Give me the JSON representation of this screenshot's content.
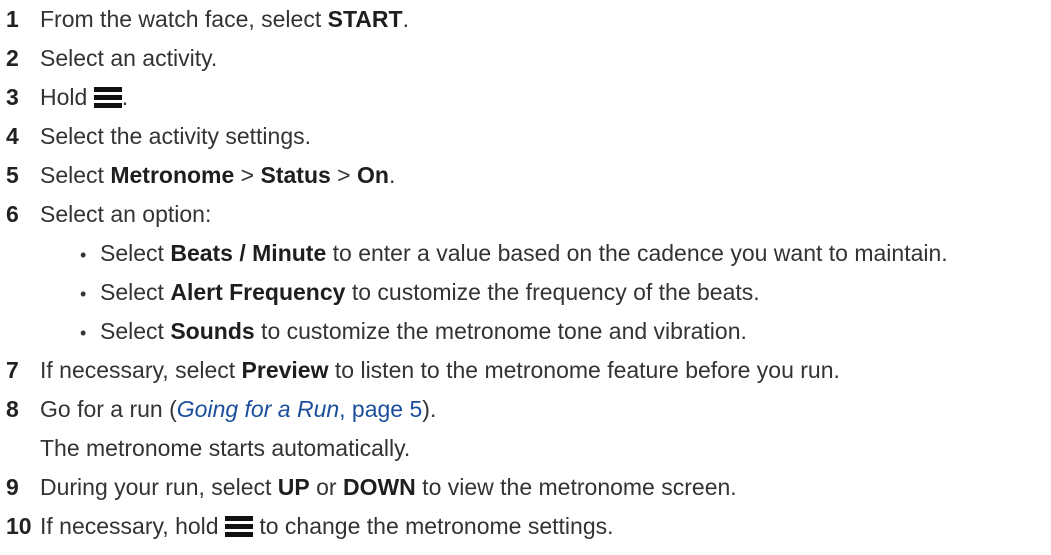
{
  "steps": [
    {
      "num": "1",
      "pre": "From the watch face, select ",
      "bold": "START",
      "post": "."
    },
    {
      "num": "2",
      "text": "Select an activity."
    },
    {
      "num": "3",
      "pre": "Hold ",
      "icon": "menu-icon",
      "post": "."
    },
    {
      "num": "4",
      "text": "Select the activity settings."
    },
    {
      "num": "5",
      "pre": "Select ",
      "b1": "Metronome",
      "sep1": " > ",
      "b2": "Status",
      "sep2": " > ",
      "b3": "On",
      "post": "."
    },
    {
      "num": "6",
      "text": "Select an option:"
    },
    {
      "num": "7",
      "pre": "If necessary, select ",
      "bold": "Preview",
      "post": " to listen to the metronome feature before you run."
    },
    {
      "num": "8",
      "pre": "Go for a run (",
      "link_italic": "Going for a Run",
      "link_page": ", page 5",
      "post": ").",
      "continuation": "The metronome starts automatically."
    },
    {
      "num": "9",
      "pre": "During your run, select ",
      "b1": "UP",
      "mid": " or ",
      "b2": "DOWN",
      "post": " to view the metronome screen."
    },
    {
      "num": "10",
      "pre": "If necessary, hold ",
      "icon": "menu-icon",
      "post": " to change the metronome settings."
    }
  ],
  "options": [
    {
      "bullet": "•",
      "pre": "Select ",
      "bold": "Beats / Minute",
      "post": " to enter a value based on the cadence you want to maintain."
    },
    {
      "bullet": "•",
      "pre": "Select ",
      "bold": "Alert Frequency",
      "post": " to customize the frequency of the beats."
    },
    {
      "bullet": "•",
      "pre": "Select ",
      "bold": "Sounds",
      "post": " to customize the metronome tone and vibration."
    }
  ],
  "colors": {
    "text": "#333333",
    "link": "#1b4f9c"
  }
}
